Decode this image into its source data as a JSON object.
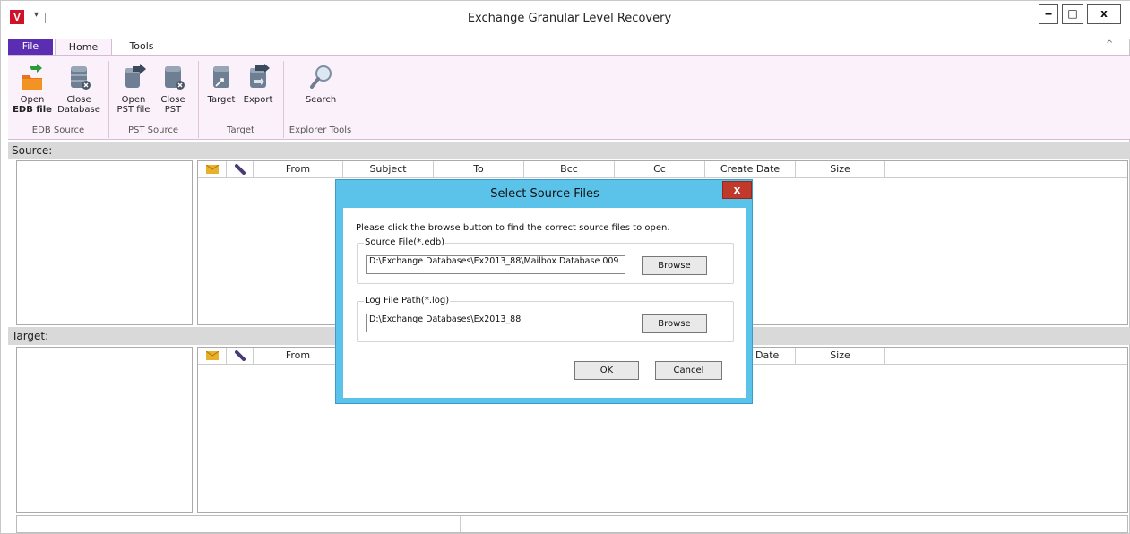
{
  "window": {
    "title": "Exchange Granular Level Recovery",
    "logo_letter": "V",
    "qat_arrow": "▾",
    "minimize": "‒",
    "maximize": "□",
    "close": "x"
  },
  "tabs": {
    "file": "File",
    "home": "Home",
    "tools": "Tools",
    "collapse": "^"
  },
  "ribbon": {
    "open_edb_1": "Open",
    "open_edb_2": "EDB file",
    "close_db_1": "Close",
    "close_db_2": "Database",
    "open_pst_1": "Open",
    "open_pst_2": "PST file",
    "close_pst_1": "Close",
    "close_pst_2": "PST",
    "target": "Target",
    "export": "Export",
    "search": "Search",
    "group_edb": "EDB Source",
    "group_pst": "PST Source",
    "group_target": "Target",
    "group_explorer": "Explorer Tools"
  },
  "source_label": "Source:",
  "target_label": "Target:",
  "grid_columns": [
    "From",
    "Subject",
    "To",
    "Bcc",
    "Cc",
    "Create Date",
    "Size"
  ],
  "target_grid_columns": [
    "From",
    "Date",
    "Size"
  ],
  "dialog": {
    "title": "Select Source Files",
    "close": "x",
    "instruction": "Please click the browse button to find the correct source files to open.",
    "source_legend": "Source File(*.edb)",
    "source_value": "D:\\Exchange Databases\\Ex2013_88\\Mailbox Database 009",
    "log_legend": "Log File Path(*.log)",
    "log_value": "D:\\Exchange Databases\\Ex2013_88",
    "browse": "Browse",
    "ok": "OK",
    "cancel": "Cancel"
  }
}
